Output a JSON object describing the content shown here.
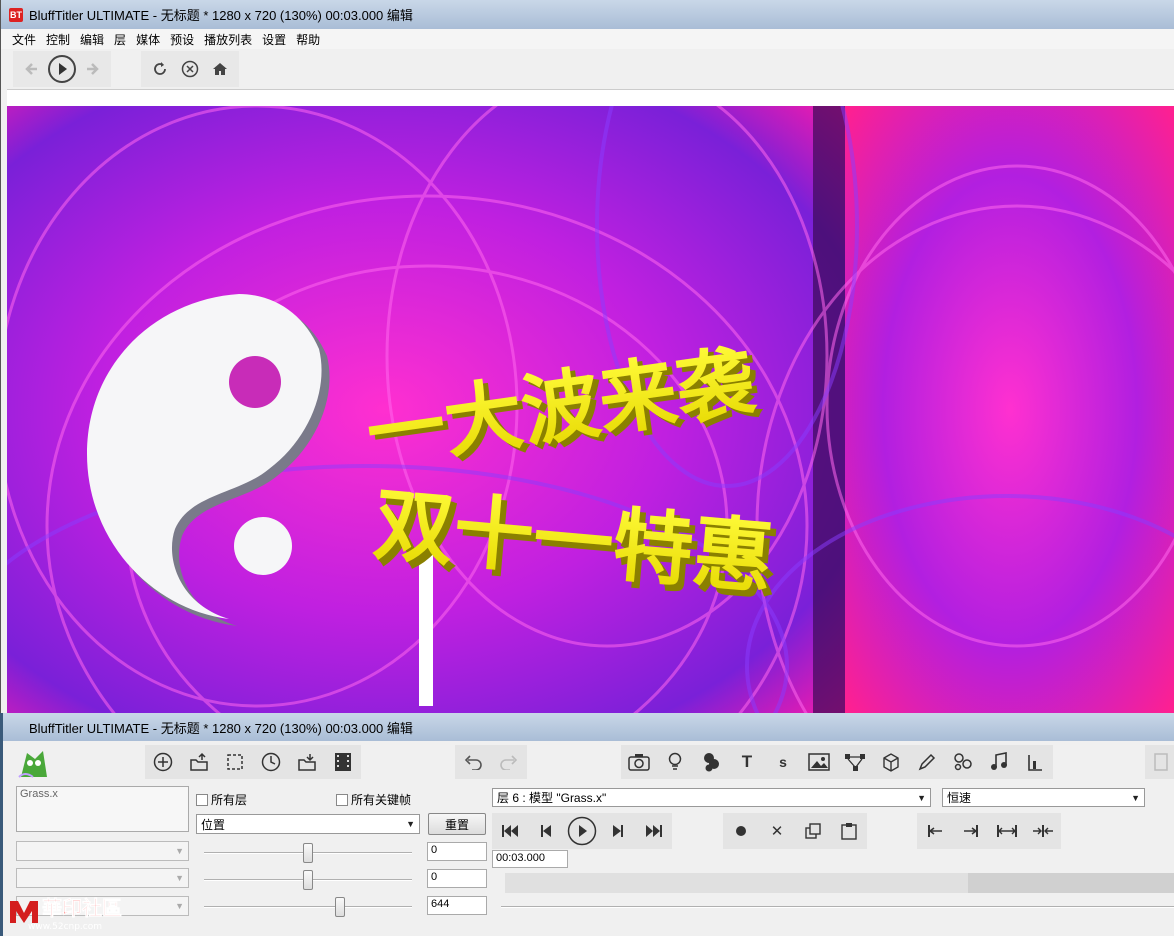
{
  "window": {
    "title": "BluffTitler ULTIMATE  - 无标题 * 1280 x 720 (130%) 00:03.000 编辑",
    "app_icon": "BT"
  },
  "menu": [
    "文件",
    "控制",
    "编辑",
    "层",
    "媒体",
    "预设",
    "播放列表",
    "设置",
    "帮助"
  ],
  "preview": {
    "line1": "一大波来袭",
    "line2": "双十一特惠"
  },
  "panel_window": {
    "title": "BluffTitler ULTIMATE  - 无标题 * 1280 x 720 (130%) 00:03.000 编辑"
  },
  "props": {
    "layer_name": "Grass.x",
    "all_layers_label": "所有层",
    "all_keyframes_label": "所有关键帧",
    "property_select": "位置",
    "reset_label": "重置",
    "values": [
      "0",
      "0",
      "644"
    ]
  },
  "layer_select": "层 6 : 模型 \"Grass.x\"",
  "speed_select": "恒速",
  "time_value": "00:03.000",
  "watermark": {
    "text": "華印社區",
    "url": "www.52cnp.com"
  },
  "colors": {
    "accent_yellow": "#f4ec1a",
    "magenta": "#ff2fd0"
  }
}
